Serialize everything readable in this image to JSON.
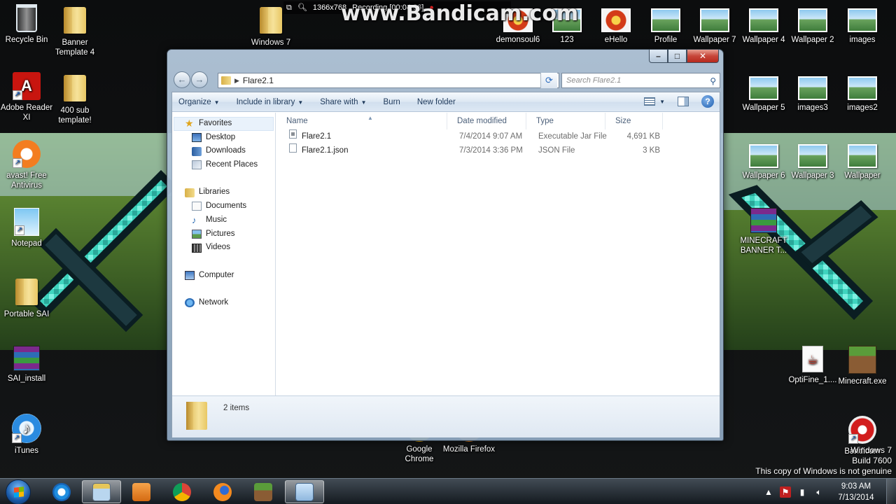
{
  "bandicam": {
    "resolution": "1366x768",
    "recording": "Recording [00:04:36]",
    "watermark": "www.Bandicam.com"
  },
  "desktop_icons": [
    {
      "label": "Recycle Bin",
      "icon": "recycle-bin-icon"
    },
    {
      "label": "Banner Template 4",
      "icon": "folder-icon"
    },
    {
      "label": "Adobe Reader XI",
      "icon": "adobe-reader-icon"
    },
    {
      "label": "400 sub template!",
      "icon": "folder-icon"
    },
    {
      "label": "avast! Free Antivirus",
      "icon": "avast-icon"
    },
    {
      "label": "Notepad",
      "icon": "notepad-icon"
    },
    {
      "label": "Portable SAI",
      "icon": "folder-icon"
    },
    {
      "label": "SAI_install",
      "icon": "winrar-icon"
    },
    {
      "label": "iTunes",
      "icon": "itunes-icon"
    },
    {
      "label": "Windows 7",
      "icon": "folder-icon"
    },
    {
      "label": "demonsoul6",
      "icon": "image-icon"
    },
    {
      "label": "123",
      "icon": "image-icon"
    },
    {
      "label": "eHello",
      "icon": "image-icon"
    },
    {
      "label": "Profile",
      "icon": "image-icon"
    },
    {
      "label": "Wallpaper 7",
      "icon": "image-icon"
    },
    {
      "label": "Wallpaper 4",
      "icon": "image-icon"
    },
    {
      "label": "Wallpaper 2",
      "icon": "image-icon"
    },
    {
      "label": "images",
      "icon": "image-icon"
    },
    {
      "label": "Wallpaper 5",
      "icon": "image-icon"
    },
    {
      "label": "images3",
      "icon": "image-icon"
    },
    {
      "label": "images2",
      "icon": "image-icon"
    },
    {
      "label": "Wallpaper 6",
      "icon": "image-icon"
    },
    {
      "label": "Wallpaper 3",
      "icon": "image-icon"
    },
    {
      "label": "Wallpaper",
      "icon": "image-icon"
    },
    {
      "label": "MINECRAFT BANNER T...",
      "icon": "winrar-icon"
    },
    {
      "label": "OptiFine_1....",
      "icon": "java-icon"
    },
    {
      "label": "Minecraft.exe",
      "icon": "minecraft-icon"
    },
    {
      "label": "Google Chrome",
      "icon": "chrome-icon"
    },
    {
      "label": "Mozilla Firefox",
      "icon": "firefox-icon"
    },
    {
      "label": "Bandicam",
      "icon": "bandicam-icon"
    }
  ],
  "explorer": {
    "address": {
      "folder": "Flare2.1"
    },
    "search_placeholder": "Search Flare2.1",
    "toolbar": {
      "organize": "Organize",
      "include_in_library": "Include in library",
      "share_with": "Share with",
      "burn": "Burn",
      "new_folder": "New folder"
    },
    "nav": {
      "favorites": "Favorites",
      "desktop": "Desktop",
      "downloads": "Downloads",
      "recent_places": "Recent Places",
      "libraries": "Libraries",
      "documents": "Documents",
      "music": "Music",
      "pictures": "Pictures",
      "videos": "Videos",
      "computer": "Computer",
      "network": "Network"
    },
    "columns": {
      "name": "Name",
      "date_modified": "Date modified",
      "type": "Type",
      "size": "Size"
    },
    "files": [
      {
        "name": "Flare2.1",
        "date": "7/4/2014 9:07 AM",
        "type": "Executable Jar File",
        "size": "4,691 KB",
        "icon": "jar-file-icon"
      },
      {
        "name": "Flare2.1.json",
        "date": "7/3/2014 3:36 PM",
        "type": "JSON File",
        "size": "3 KB",
        "icon": "json-file-icon"
      }
    ],
    "status": {
      "item_count": "2 items"
    }
  },
  "watermark_text": {
    "line1": "Windows 7",
    "line2": "Build 7600",
    "line3": "This copy of Windows is not genuine"
  },
  "taskbar": {
    "apps": [
      "Internet Explorer",
      "Windows Explorer",
      "Windows Media Center",
      "Google Chrome",
      "Mozilla Firefox",
      "Minecraft",
      "Bandicam"
    ],
    "clock": {
      "time": "9:03 AM",
      "date": "7/13/2014"
    }
  },
  "colors": {
    "taskbar": "#1a2028",
    "window_frame": "#a9bed3",
    "link_text": "#1e395b",
    "close_button": "#c7463a"
  }
}
